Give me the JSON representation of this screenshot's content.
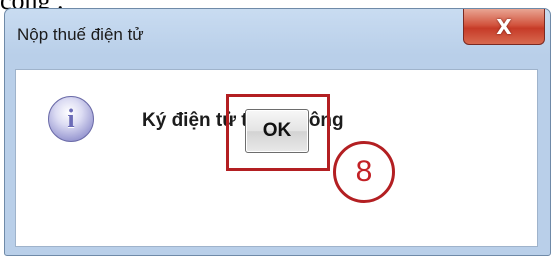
{
  "top_text": "công .",
  "dialog": {
    "title": "Nộp thuế điện tử",
    "close_label": "X",
    "message": "Ký điện tử thành công",
    "icon": "info-icon",
    "icon_glyph": "i",
    "ok_label": "OK"
  },
  "annotation": {
    "step_number": "8",
    "color": "#b31f22"
  }
}
